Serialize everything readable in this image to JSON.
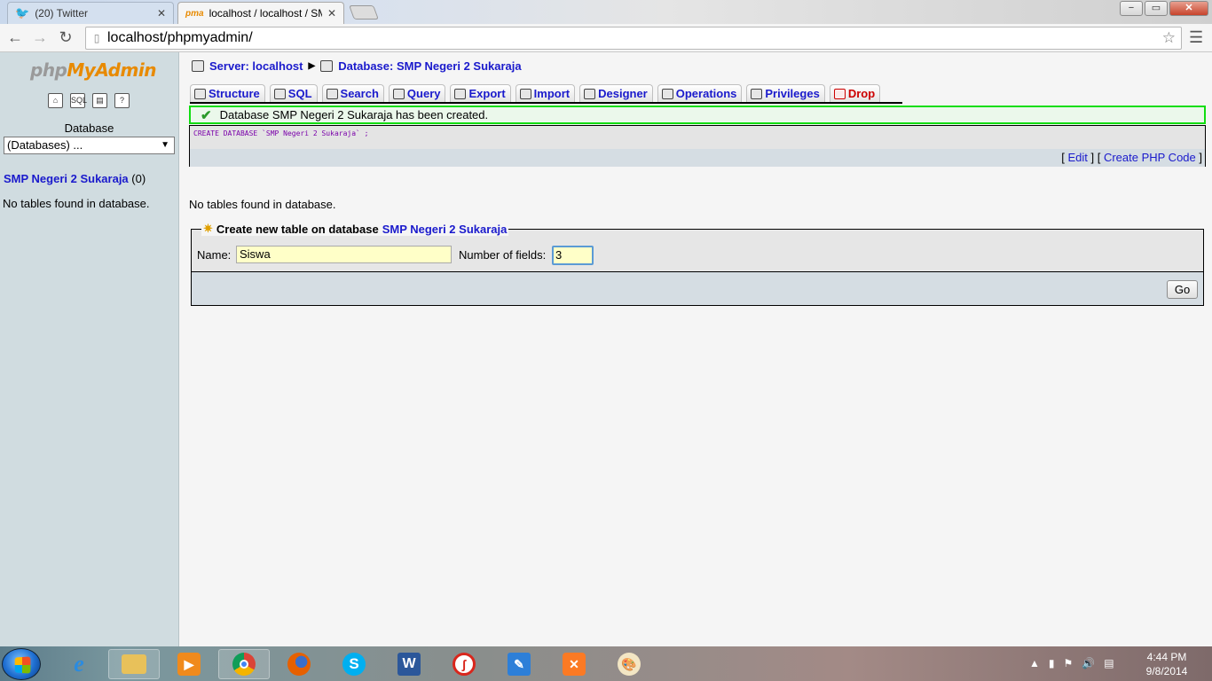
{
  "browser": {
    "tabs": [
      {
        "title": "(20) Twitter",
        "icon": "twitter-bird-icon"
      },
      {
        "title": "localhost / localhost / SMP",
        "icon": "pma-favicon-icon"
      }
    ],
    "address": "localhost/phpmyadmin/",
    "window_controls": {
      "minimize": "−",
      "maximize": "▭",
      "close": "✕"
    }
  },
  "sidebar": {
    "logo_php": "php",
    "logo_myadmin": "MyAdmin",
    "quick_icons": [
      "home-icon",
      "sql-icon",
      "query-window-icon",
      "docs-icon"
    ],
    "database_label": "Database",
    "database_select": "(Databases) ...",
    "current_db": "SMP Negeri 2 Sukaraja",
    "current_db_count": "(0)",
    "no_tables": "No tables found in database."
  },
  "main": {
    "breadcrumb": {
      "server": "Server: localhost",
      "database": "Database: SMP Negeri 2 Sukaraja"
    },
    "tabs": [
      {
        "label": "Structure",
        "icon": "structure-icon"
      },
      {
        "label": "SQL",
        "icon": "sql-icon"
      },
      {
        "label": "Search",
        "icon": "search-icon"
      },
      {
        "label": "Query",
        "icon": "query-icon"
      },
      {
        "label": "Export",
        "icon": "export-icon"
      },
      {
        "label": "Import",
        "icon": "import-icon"
      },
      {
        "label": "Designer",
        "icon": "designer-icon"
      },
      {
        "label": "Operations",
        "icon": "operations-icon"
      },
      {
        "label": "Privileges",
        "icon": "privileges-icon"
      },
      {
        "label": "Drop",
        "icon": "drop-icon"
      }
    ],
    "success_message": "Database SMP Negeri 2 Sukaraja has been created.",
    "sql_query": "CREATE DATABASE `SMP Negeri 2 Sukaraja` ;",
    "sql_links": {
      "edit": "Edit",
      "create_php": "Create PHP Code"
    },
    "no_tables": "No tables found in database.",
    "create_table": {
      "legend": "Create new table on database",
      "legend_db": "SMP Negeri 2 Sukaraja",
      "name_label": "Name:",
      "name_value": "Siswa",
      "fields_label": "Number of fields:",
      "fields_value": "3",
      "go_label": "Go"
    }
  },
  "taskbar": {
    "apps": [
      "ie-icon",
      "explorer-icon",
      "media-player-icon",
      "chrome-icon",
      "firefox-icon",
      "skype-icon",
      "word-icon",
      "app-red-icon",
      "paint-net-icon",
      "xampp-icon",
      "paint-icon"
    ],
    "time": "4:44 PM",
    "date": "9/8/2014"
  },
  "colors": {
    "sidebar_bg": "#d0dce0",
    "link": "#1a1acc",
    "success_border": "#11dd11",
    "drop": "#cc0000"
  }
}
